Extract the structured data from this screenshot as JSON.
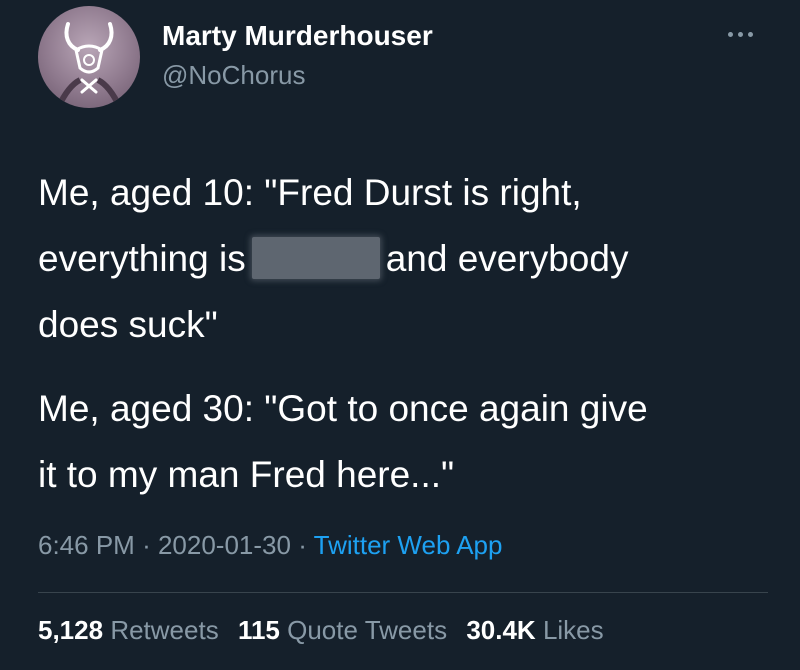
{
  "author": {
    "display_name": "Marty Murderhouser",
    "handle": "@NoChorus"
  },
  "tweet": {
    "para1_line1": "Me, aged 10: \"Fred Durst is right,",
    "para1_line2_before": "everything is",
    "para1_line2_after": "and everybody",
    "para1_line3": "does suck\"",
    "para2_line1": "Me, aged 30: \"Got to once again give",
    "para2_line2": "it to my man Fred here...\""
  },
  "meta": {
    "time": "6:46 PM",
    "separator": "·",
    "date": "2020-01-30",
    "app": "Twitter Web App"
  },
  "stats": {
    "retweets_count": "5,128",
    "retweets_label": "Retweets",
    "quotes_count": "115",
    "quotes_label": "Quote Tweets",
    "likes_count": "30.4K",
    "likes_label": "Likes"
  },
  "icons": {
    "avatar": "horned-skull-avatar",
    "more": "more-options-icon"
  },
  "colors": {
    "background": "#15202b",
    "text_primary": "#ffffff",
    "text_secondary": "#8899a6",
    "link": "#1da1f2",
    "divider": "#38444d"
  }
}
